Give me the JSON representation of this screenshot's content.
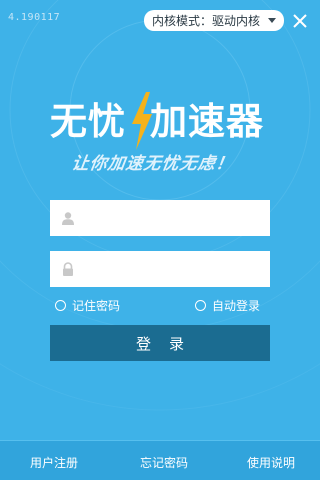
{
  "window": {
    "version": "4.190117",
    "mode_select": {
      "value": "内核模式：驱动内核"
    },
    "close_icon": "close-icon"
  },
  "brand": {
    "name_left": "无忧",
    "name_right": "加速器",
    "slogan": "让你加速无忧无虑！",
    "bolt_color": "#f5b21a"
  },
  "login": {
    "username": {
      "value": "",
      "icon": "user-icon"
    },
    "password": {
      "value": "",
      "icon": "lock-icon"
    },
    "remember_label": "记住密码",
    "auto_login_label": "自动登录",
    "login_label": "登录"
  },
  "footer": {
    "register": "用户注册",
    "forgot": "忘记密码",
    "help": "使用说明"
  },
  "colors": {
    "background": "#3eb2e8",
    "button": "#1b6c91",
    "footer": "#31a4dc"
  }
}
